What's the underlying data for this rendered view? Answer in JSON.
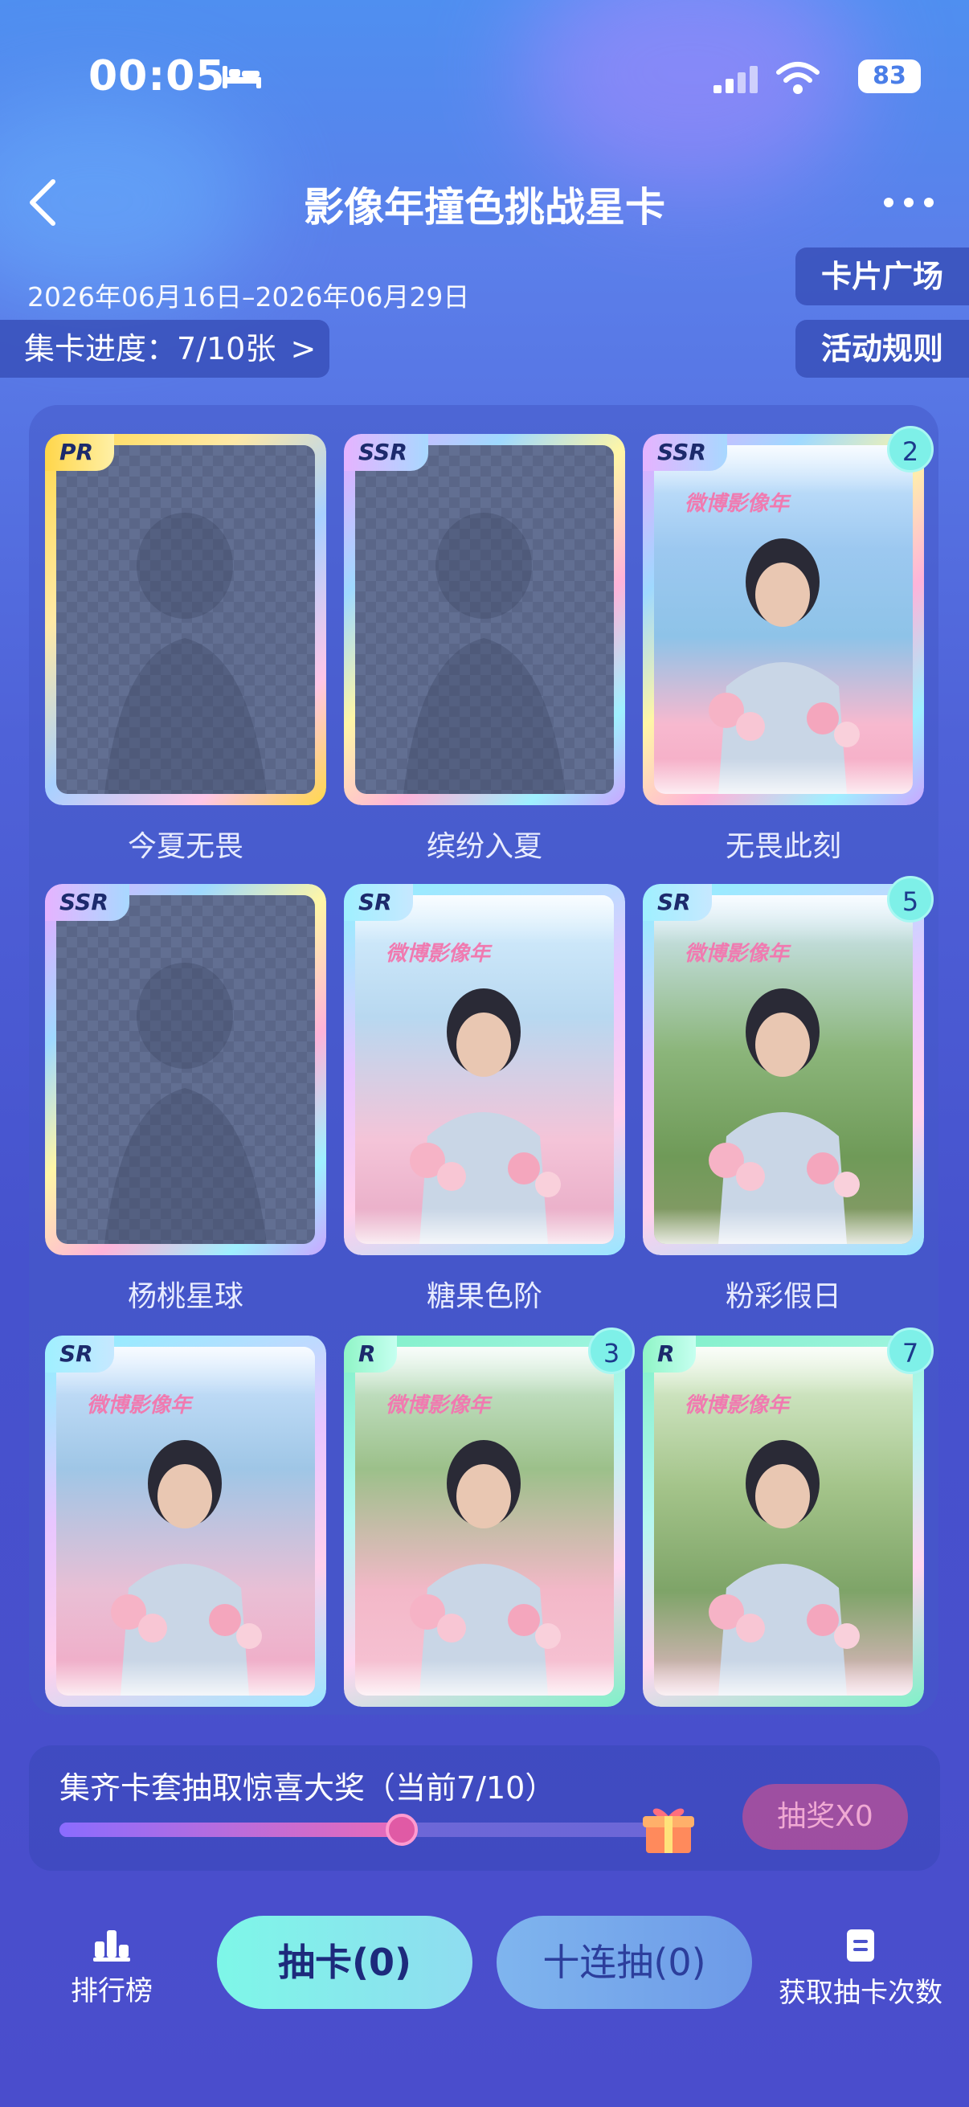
{
  "status_bar": {
    "time": "00:05",
    "battery": "83"
  },
  "header": {
    "title": "影像年撞色挑战星卡",
    "date_range": "2026年06月16日–2026年06月29日"
  },
  "buttons": {
    "card_plaza": "卡片广场",
    "rules": "活动规则"
  },
  "progress": {
    "label": "集卡进度：7/10张",
    "chevron": ">"
  },
  "cards": [
    {
      "rarity": "PR",
      "name": "今夏无畏",
      "count": "",
      "collected": false,
      "frame": "gold"
    },
    {
      "rarity": "SSR",
      "name": "缤纷入夏",
      "count": "",
      "collected": false,
      "frame": "rainbow"
    },
    {
      "rarity": "SSR",
      "name": "无畏此刻",
      "count": "2",
      "collected": true,
      "frame": "rainbow"
    },
    {
      "rarity": "SSR",
      "name": "杨桃星球",
      "count": "",
      "collected": false,
      "frame": "rainbow"
    },
    {
      "rarity": "SR",
      "name": "糖果色阶",
      "count": "",
      "collected": true,
      "frame": "cyan"
    },
    {
      "rarity": "SR",
      "name": "粉彩假日",
      "count": "5",
      "collected": true,
      "frame": "cyan"
    },
    {
      "rarity": "SR",
      "name": "",
      "count": "",
      "collected": true,
      "frame": "cyan"
    },
    {
      "rarity": "R",
      "name": "",
      "count": "3",
      "collected": true,
      "frame": "green"
    },
    {
      "rarity": "R",
      "name": "",
      "count": "7",
      "collected": true,
      "frame": "green"
    }
  ],
  "poster": {
    "brand": "微博影像年"
  },
  "reward": {
    "text": "集齐卡套抽取惊喜大奖（当前7/10）",
    "progress": 0.7,
    "draw_label": "抽奖X0"
  },
  "bottom_nav": {
    "rank": "排行榜",
    "draw": "抽卡(0)",
    "ten_draw": "十连抽(0)",
    "get_chances": "获取抽卡次数"
  },
  "colors": {
    "accent_cyan": "#7ef7e8",
    "accent_pink": "#e86bb9",
    "panel": "#4652cd"
  }
}
